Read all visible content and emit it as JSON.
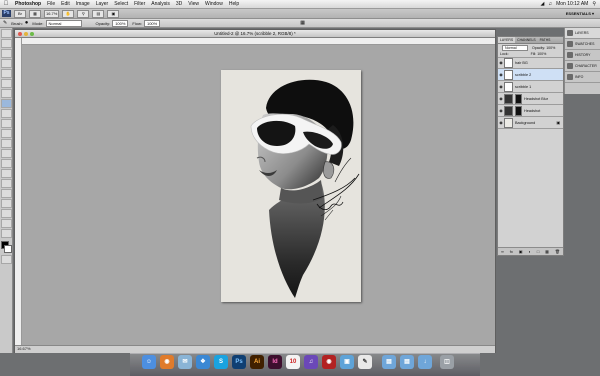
{
  "menubar": {
    "app_name": "Photoshop",
    "items": [
      "File",
      "Edit",
      "Image",
      "Layer",
      "Select",
      "Filter",
      "Analysis",
      "3D",
      "View",
      "Window",
      "Help"
    ],
    "clock": "Mon 10:12 AM"
  },
  "appbar": {
    "app_icon": "Ps",
    "zoom": "16.7%",
    "workspace": "ESSENTIALS ▾"
  },
  "options": {
    "brush_label": "Brush:",
    "mode_label": "Mode:",
    "mode_value": "Normal",
    "opacity_label": "Opacity:",
    "opacity_value": "100%",
    "flow_label": "Flow:",
    "flow_value": "100%"
  },
  "document": {
    "title": "Untitled-2 @ 16.7% (scribble 2, RGB/8) *",
    "zoom_readout": "16.67%"
  },
  "layers_panel": {
    "tabs": [
      "LAYERS",
      "CHANNELS",
      "PATHS"
    ],
    "blend_mode": "Normal",
    "opacity_label": "Opacity:",
    "opacity_value": "100%",
    "lock_label": "Lock:",
    "fill_label": "Fill:",
    "fill_value": "100%",
    "layers": [
      {
        "name": "hair BG"
      },
      {
        "name": "scribble 2"
      },
      {
        "name": "scribble 1"
      },
      {
        "name": "Headshot Blur"
      },
      {
        "name": "Headshot"
      },
      {
        "name": "Background"
      }
    ]
  },
  "panel_strip": {
    "items": [
      {
        "label": "LAYERS",
        "icon": "layers-icon"
      },
      {
        "label": "SWATCHES",
        "icon": "swatches-icon"
      },
      {
        "label": "HISTORY",
        "icon": "history-icon"
      },
      {
        "label": "CHARACTER",
        "icon": "character-icon"
      },
      {
        "label": "INFO",
        "icon": "info-icon"
      }
    ]
  },
  "dock": {
    "icons": [
      "finder-icon",
      "firefox-icon",
      "mail-icon",
      "safari-icon",
      "skype-icon",
      "photoshop-icon",
      "illustrator-icon",
      "indesign-icon",
      "calendar-icon",
      "itunes-icon",
      "photobooth-icon",
      "preview-icon",
      "textedit-icon",
      "folder-icon",
      "folder-icon",
      "downloads-icon",
      "trash-icon"
    ],
    "labels": {
      "photoshop": "Ps",
      "illustrator": "Ai",
      "indesign": "Id"
    }
  },
  "colors": {
    "workspace_bg": "#6d6f71",
    "canvas": "#e6e4de",
    "selected_layer": "#cfe0f5",
    "ps_blue": "#2a3f6a"
  }
}
